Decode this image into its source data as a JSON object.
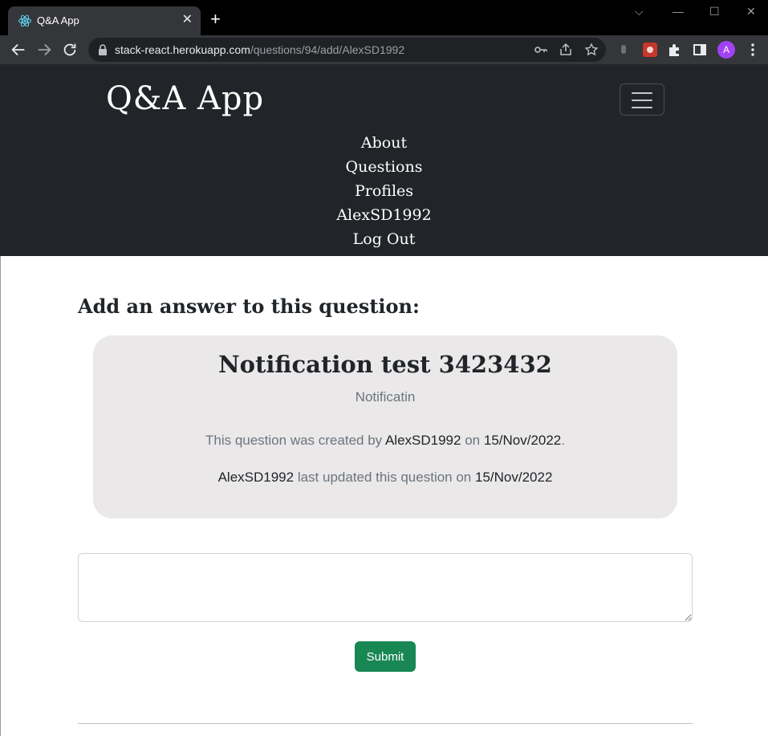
{
  "browser": {
    "tab": {
      "title": "Q&A App",
      "favicon": "react-atom-icon",
      "close": "✕"
    },
    "new_tab": "+",
    "window_controls": {
      "tab_search": "⌵",
      "minimize": "—",
      "maximize": "☐",
      "close": "✕"
    },
    "url": {
      "domain": "stack-react.herokuapp.com",
      "path": "/questions/94/add/AlexSD1992"
    },
    "profile_initial": "A",
    "colors": {
      "tabbar": "#000000",
      "toolbar": "#35363a",
      "omnibox": "#202124",
      "profile": "#a142f4"
    }
  },
  "navbar": {
    "brand": "Q&A App",
    "links": [
      "About",
      "Questions",
      "Profiles",
      "AlexSD1992",
      "Log Out"
    ],
    "background": "#212529"
  },
  "main": {
    "heading": "Add an answer to this question:",
    "question": {
      "title": "Notification test 3423432",
      "body": "Notificatin",
      "created": {
        "prefix": "This question was created by",
        "author": "AlexSD1992",
        "on": "on",
        "date": "15/Nov/2022",
        "suffix": "."
      },
      "updated": {
        "author": "AlexSD1992",
        "middle": "last updated this question on",
        "date": "15/Nov/2022"
      },
      "card_color": "#eae8e9"
    },
    "answer": {
      "value": "",
      "placeholder": ""
    },
    "submit_label": "Submit",
    "submit_color": "#198754"
  }
}
